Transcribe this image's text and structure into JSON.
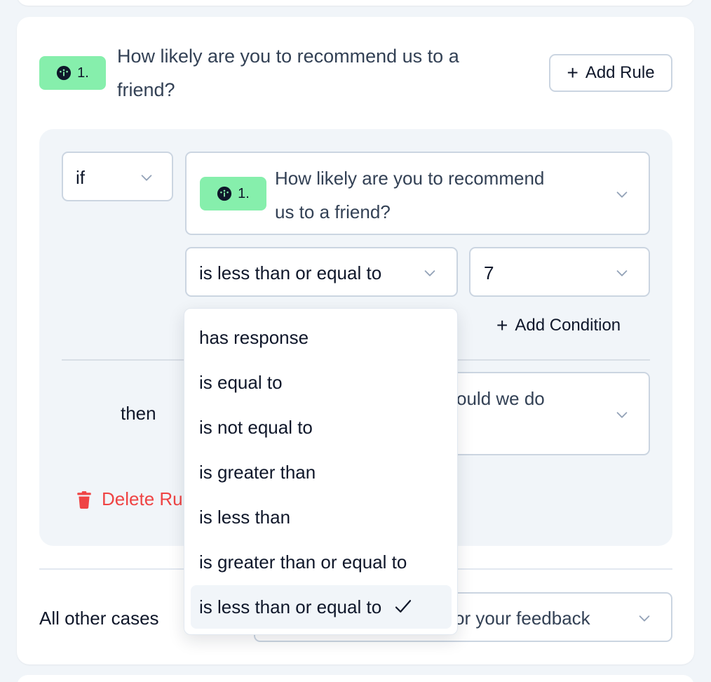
{
  "question": {
    "number": "1.",
    "title_line1": "How likely are you to recommend us to a",
    "title_line2": "friend?",
    "icon": "gauge-icon"
  },
  "add_rule_label": "Add Rule",
  "rule": {
    "if_label": "if",
    "selected_question": {
      "number": "1.",
      "line1": "How likely are you to recommend",
      "line2": "us to a friend?"
    },
    "operator": "is less than or equal to",
    "value": "7",
    "add_condition_label": "Add Condition",
    "then_label": "then",
    "then_target_line1": "could we do",
    "then_target_line2": "?",
    "delete_label": "Delete Rule"
  },
  "all_other_cases_label": "All other cases",
  "all_other_target": "or your feedback",
  "dropdown": {
    "options": [
      "has response",
      "is equal to",
      "is not equal to",
      "is greater than",
      "is less than",
      "is greater than or equal to",
      "is less than or equal to"
    ],
    "selected_index": 6
  },
  "colors": {
    "badge": "#86efac",
    "danger": "#ef4444",
    "panel": "#f1f5f9"
  }
}
